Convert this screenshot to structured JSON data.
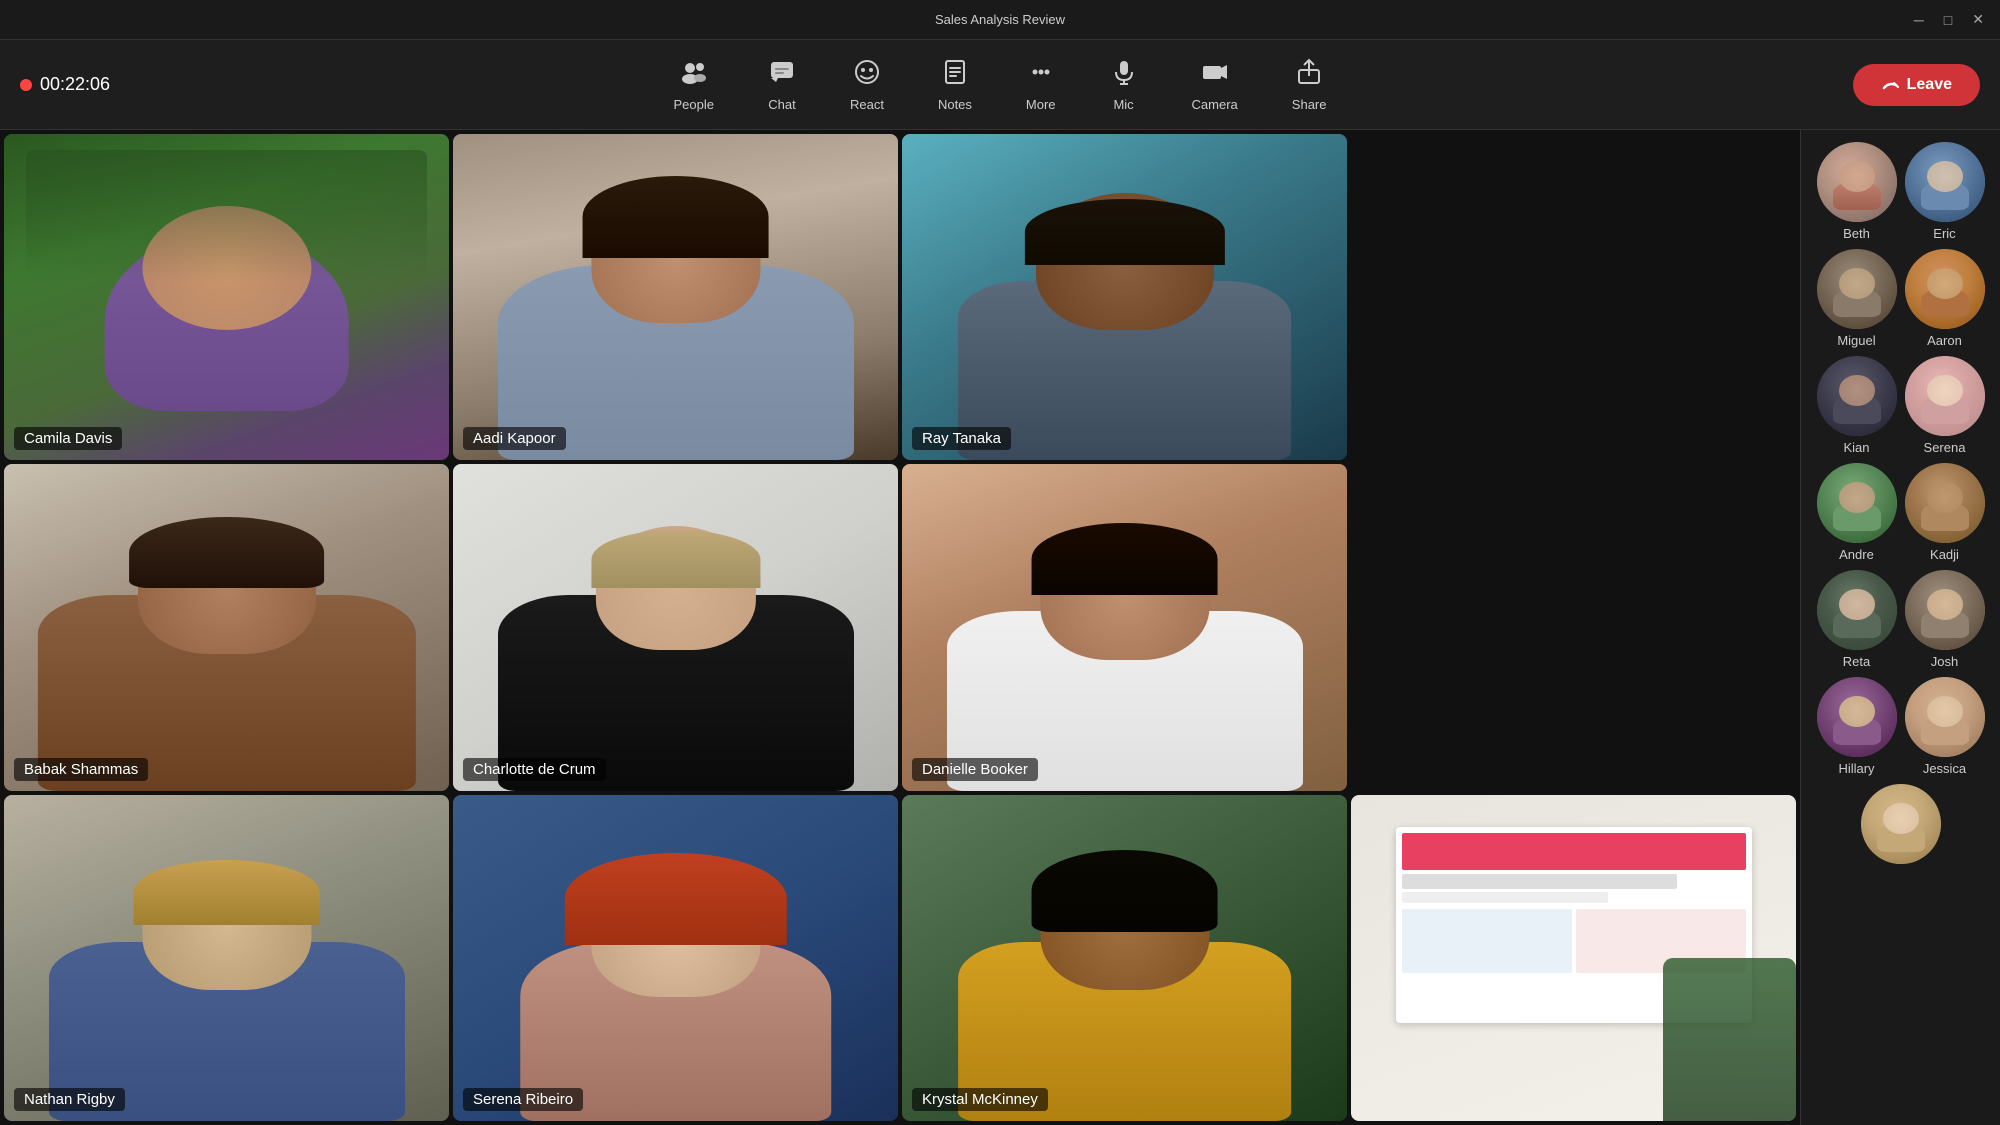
{
  "titleBar": {
    "title": "Sales Analysis Review",
    "minimize": "─",
    "maximize": "□",
    "close": "✕"
  },
  "toolbar": {
    "timer": "00:22:06",
    "buttons": [
      {
        "id": "people",
        "icon": "👥",
        "label": "People"
      },
      {
        "id": "chat",
        "icon": "💬",
        "label": "Chat"
      },
      {
        "id": "react",
        "icon": "😊",
        "label": "React"
      },
      {
        "id": "notes",
        "icon": "📋",
        "label": "Notes"
      },
      {
        "id": "more",
        "icon": "•••",
        "label": "More"
      },
      {
        "id": "mic",
        "icon": "🎙",
        "label": "Mic"
      },
      {
        "id": "camera",
        "icon": "📷",
        "label": "Camera"
      },
      {
        "id": "share",
        "icon": "↑",
        "label": "Share"
      }
    ],
    "leaveButton": "Leave"
  },
  "videoGrid": {
    "participants": [
      {
        "id": "camila",
        "name": "Camila Davis",
        "bgClass": "tile-camila",
        "col": 1,
        "row": 1
      },
      {
        "id": "aadi",
        "name": "Aadi Kapoor",
        "bgClass": "tile-aadi",
        "col": 2,
        "row": 1
      },
      {
        "id": "ray",
        "name": "Ray Tanaka",
        "bgClass": "tile-ray",
        "col": 3,
        "row": 1
      },
      {
        "id": "babak",
        "name": "Babak Shammas",
        "bgClass": "tile-babak",
        "col": 1,
        "row": 2
      },
      {
        "id": "charlotte",
        "name": "Charlotte de Crum",
        "bgClass": "tile-charlotte",
        "col": 2,
        "row": 2
      },
      {
        "id": "danielle",
        "name": "Danielle Booker",
        "bgClass": "tile-danielle",
        "col": 3,
        "row": 2
      },
      {
        "id": "nathan",
        "name": "Nathan Rigby",
        "bgClass": "tile-nathan",
        "col": 1,
        "row": 3
      },
      {
        "id": "serena_r",
        "name": "Serena Ribeiro",
        "bgClass": "tile-serena-r",
        "col": 2,
        "row": 3
      },
      {
        "id": "krystal",
        "name": "Krystal McKinney",
        "bgClass": "tile-krystal",
        "col": 3,
        "row": 3
      },
      {
        "id": "presentation",
        "name": "",
        "bgClass": "tile-presentation",
        "col": 4,
        "row": 3
      }
    ]
  },
  "sidebar": {
    "participants": [
      {
        "id": "beth",
        "name": "Beth",
        "bgClass": "av-beth"
      },
      {
        "id": "eric",
        "name": "Eric",
        "bgClass": "av-eric"
      },
      {
        "id": "miguel",
        "name": "Miguel",
        "bgClass": "av-miguel"
      },
      {
        "id": "aaron",
        "name": "Aaron",
        "bgClass": "av-aaron"
      },
      {
        "id": "kian",
        "name": "Kian",
        "bgClass": "av-kian"
      },
      {
        "id": "serena",
        "name": "Serena",
        "bgClass": "av-serena"
      },
      {
        "id": "andre",
        "name": "Andre",
        "bgClass": "av-andre"
      },
      {
        "id": "kadji",
        "name": "Kadji",
        "bgClass": "av-kadji"
      },
      {
        "id": "reta",
        "name": "Reta",
        "bgClass": "av-reta"
      },
      {
        "id": "josh",
        "name": "Josh",
        "bgClass": "av-josh"
      },
      {
        "id": "hillary",
        "name": "Hillary",
        "bgClass": "av-hillary"
      },
      {
        "id": "jessica",
        "name": "Jessica",
        "bgClass": "av-jessica"
      },
      {
        "id": "bottom",
        "name": "",
        "bgClass": "av-bottom"
      }
    ]
  },
  "colors": {
    "accent": "#d13438",
    "bg": "#1a1a1a",
    "toolbar": "#1e1e1e"
  }
}
